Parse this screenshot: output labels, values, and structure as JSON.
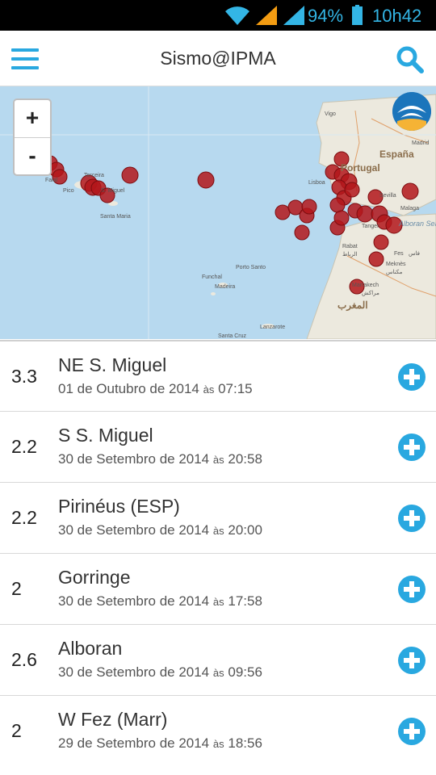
{
  "status": {
    "battery": "94%",
    "time": "10h42"
  },
  "header": {
    "title": "Sismo@IPMA"
  },
  "map": {
    "zoom_in": "+",
    "zoom_out": "-",
    "labels": {
      "faial": "Faial",
      "terceira": "Terceira",
      "pico": "Pico",
      "sao_miguel": "S. Miguel",
      "santa_maria": "Santa Maria",
      "vigo": "Vigo",
      "madrid": "Madrid",
      "espana": "España",
      "portugal": "Portugal",
      "lisboa": "Lisboa",
      "sevilla": "Sevilla",
      "malaga": "Malaga",
      "tanger": "Tanger",
      "alboran": "Alboran Sea",
      "rabat": "Rabat",
      "rabat_ar": "الرباط",
      "fes": "Fes",
      "fes_ar": "فاس",
      "meknes": "Meknès",
      "meknes_ar": "مكناس",
      "marrakech": "Marrakech",
      "marrakech_ar": "مراكش",
      "morocco_ar": "المغرب",
      "funchal": "Funchal",
      "madeira": "Madeira",
      "porto_santo": "Porto Santo",
      "lanzarote": "Lanzarote",
      "santa_cruz": "Santa Cruz"
    }
  },
  "events": [
    {
      "magnitude": "3.3",
      "place": "NE S. Miguel",
      "date": "01 de Outubro de 2014",
      "sep": "às",
      "time": "07:15"
    },
    {
      "magnitude": "2.2",
      "place": "S S. Miguel",
      "date": "30 de Setembro de 2014",
      "sep": "às",
      "time": "20:58"
    },
    {
      "magnitude": "2.2",
      "place": "Pirinéus (ESP)",
      "date": "30 de Setembro de 2014",
      "sep": "às",
      "time": "20:00"
    },
    {
      "magnitude": "2",
      "place": "Gorringe",
      "date": "30 de Setembro de 2014",
      "sep": "às",
      "time": "17:58"
    },
    {
      "magnitude": "2.6",
      "place": "Alboran",
      "date": "30 de Setembro de 2014",
      "sep": "às",
      "time": "09:56"
    },
    {
      "magnitude": "2",
      "place": "W Fez (Marr)",
      "date": "29 de Setembro de 2014",
      "sep": "às",
      "time": "18:56"
    }
  ],
  "colors": {
    "accent": "#29a8e0",
    "quake": "#b3161b",
    "sea": "#b7d9ef",
    "land": "#ece9de"
  }
}
